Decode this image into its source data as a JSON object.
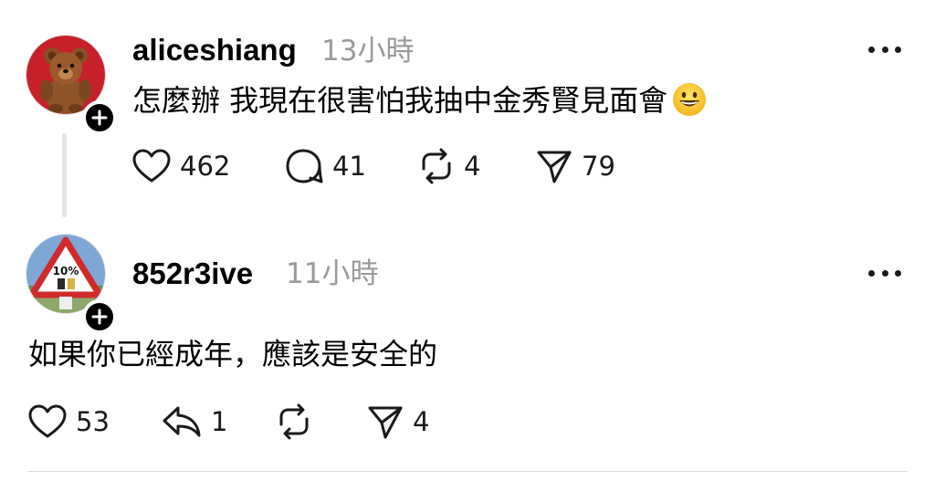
{
  "posts": [
    {
      "username": "aliceshiang",
      "time": "13小時",
      "text": "怎麼辦 我現在很害怕我抽中金秀賢見面會",
      "emoji": "grinning-face-emoji",
      "avatar": "teddy-bear-avatar",
      "likes": "462",
      "comments": "41",
      "reposts": "4",
      "shares": "79"
    },
    {
      "username": "852r3ive",
      "time": "11小時",
      "text": "如果你已經成年，應該是安全的",
      "avatar": "warning-sign-avatar",
      "likes": "53",
      "replies": "1",
      "shares": "4"
    }
  ],
  "icons": {
    "like": "heart-icon",
    "comment": "comment-bubble-icon",
    "repost": "repost-icon",
    "reply": "reply-arrow-icon",
    "share": "send-icon",
    "more": "more-options-icon",
    "follow": "plus-icon"
  },
  "colors": {
    "text": "#000000",
    "muted": "#9a9a9a",
    "badge": "#000000",
    "thread_line": "#e3e3e3"
  }
}
